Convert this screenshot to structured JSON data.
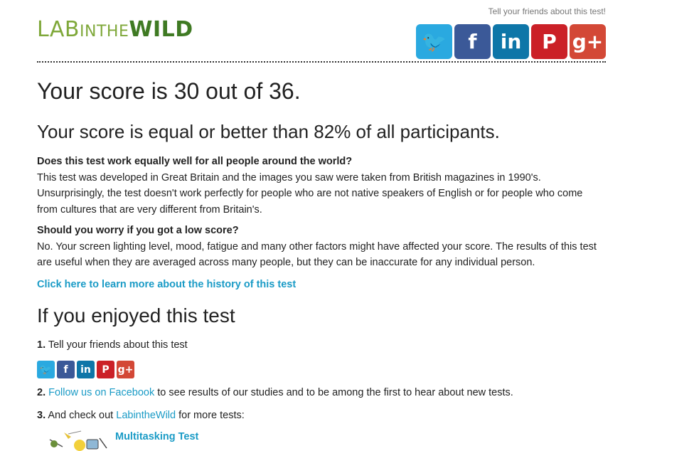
{
  "header": {
    "logo": {
      "lab": "LAB",
      "in": "IN",
      "the": "THE",
      "wild": "WILD"
    },
    "share_prompt": "Tell your friends about this test!",
    "share_icons": [
      "twitter-icon",
      "facebook-icon",
      "linkedin-icon",
      "pinterest-icon",
      "google-plus-icon"
    ],
    "glyphs": {
      "twitter": "🐦",
      "facebook": "f",
      "linkedin": "in",
      "pinterest": "P",
      "google_plus": "g+"
    }
  },
  "result": {
    "score_text": "Your score is 30 out of 36.",
    "percentile_text": "Your score is equal or better than 82% of all participants."
  },
  "faq": [
    {
      "question": "Does this test work equally well for all people around the world?",
      "answer": "This test was developed in Great Britain and the images you saw were taken from British magazines in 1990's. Unsurprisingly, the test doesn't work perfectly for people who are not native speakers of English or for people who come from cultures that are very different from Britain's."
    },
    {
      "question": "Should you worry if you got a low score?",
      "answer": "No. Your screen lighting level, mood, fatigue and many other factors might have affected your score. The results of this test are useful when they are averaged across many people, but they can be inaccurate for any individual person."
    }
  ],
  "history_link": "Click here to learn more about the history of this test",
  "enjoy": {
    "heading": "If you enjoyed this test",
    "step1_num": "1.",
    "step1_text": " Tell your friends about this test",
    "step2_num": "2.",
    "step2_link": "Follow us on Facebook",
    "step2_text": " to see results of our studies and to be among the first to hear about new tests.",
    "step3_num": "3.",
    "step3_pre": " And check out ",
    "step3_link": "LabintheWild",
    "step3_post": " for more tests:",
    "more_test": "Multitasking Test"
  },
  "colors": {
    "link": "#1a9bc6",
    "logo_light": "#7fa83a",
    "logo_dark": "#3f7a23",
    "twitter": "#2aa9e0",
    "facebook": "#3b5998",
    "linkedin": "#0e76a8",
    "pinterest": "#cb2027",
    "google_plus": "#d34836"
  }
}
